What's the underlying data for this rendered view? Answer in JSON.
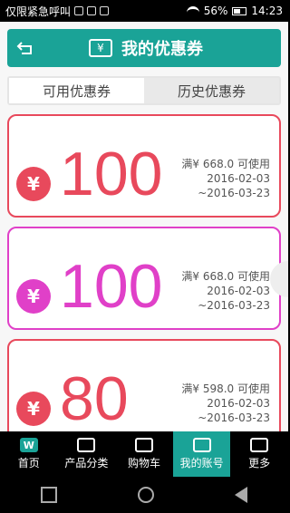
{
  "status_bar": {
    "left_text": "仅限紧急呼叫",
    "battery": "56%",
    "time": "14:23"
  },
  "header": {
    "title": "我的优惠券",
    "back_icon": "back-arrow-icon",
    "wallet_symbol": "¥"
  },
  "tabs": [
    {
      "label": "可用优惠券",
      "active": true
    },
    {
      "label": "历史优惠券",
      "active": false
    }
  ],
  "coupons": [
    {
      "amount": "100",
      "condition": "满¥ 668.0 可使用",
      "start": "2016-02-03",
      "end": "~2016-03-23",
      "color": "#e8495c",
      "currency": "¥"
    },
    {
      "amount": "100",
      "condition": "满¥ 668.0 可使用",
      "start": "2016-02-03",
      "end": "~2016-03-23",
      "color": "#e040c8",
      "currency": "¥"
    },
    {
      "amount": "80",
      "condition": "满¥ 598.0 可使用",
      "start": "2016-02-03",
      "end": "~2016-03-23",
      "color": "#e8495c",
      "currency": "¥"
    }
  ],
  "bottom_nav": [
    {
      "label": "首页",
      "icon": "home-icon"
    },
    {
      "label": "产品分类",
      "icon": "category-icon"
    },
    {
      "label": "购物车",
      "icon": "cart-icon"
    },
    {
      "label": "我的账号",
      "icon": "account-icon",
      "active": true
    },
    {
      "label": "更多",
      "icon": "more-icon"
    }
  ]
}
